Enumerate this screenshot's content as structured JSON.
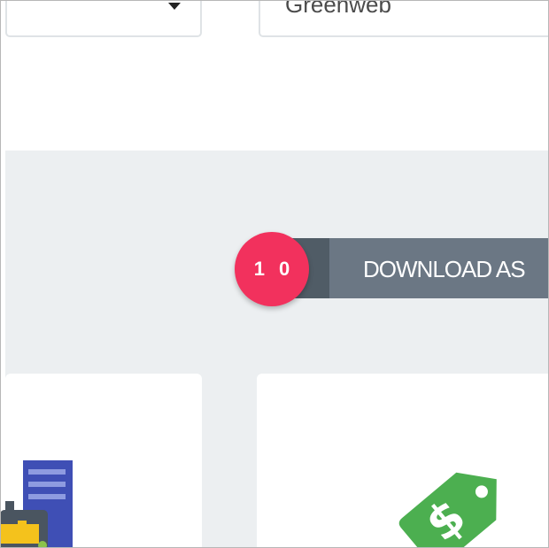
{
  "top_controls": {
    "text_field_value": "Greenweb"
  },
  "download": {
    "badge_number": "1 0",
    "button_label": "DOWNLOAD AS"
  },
  "cards": [
    {
      "icon": "document-briefcase-icon"
    },
    {
      "icon": "price-tag-dollar-icon"
    }
  ],
  "colors": {
    "gray_section": "#eceff1",
    "button": "#6b7784",
    "button_dark": "#505c66",
    "badge": "#f2315d",
    "tag_green": "#4caf50",
    "doc_blue": "#3f4fb5"
  }
}
